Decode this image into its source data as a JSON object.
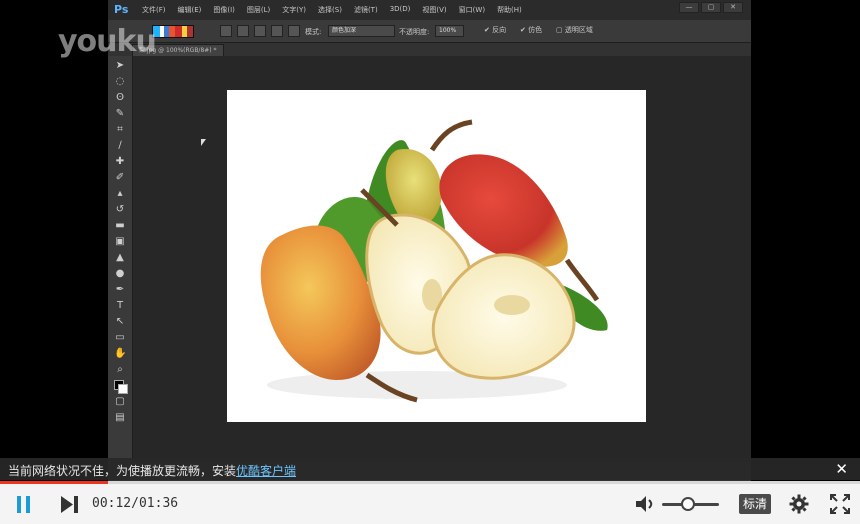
{
  "watermark": "youku",
  "photoshop": {
    "logo": "Ps",
    "menu": [
      "文件(F)",
      "编辑(E)",
      "图像(I)",
      "图层(L)",
      "文字(Y)",
      "选择(S)",
      "滤镜(T)",
      "3D(D)",
      "视图(V)",
      "窗口(W)",
      "帮助(H)"
    ],
    "window_controls": [
      "—",
      "▢",
      "✕"
    ],
    "options": {
      "mode_label": "模式:",
      "mode_value": "颜色加深",
      "opacity_label": "不透明度:",
      "opacity_value": "100%",
      "reverse_label": "反向",
      "dither_label": "仿色",
      "transparency_label": "透明区域"
    },
    "doc_tab": "梨.jpg @ 100%(RGB/8#) *",
    "tools": [
      "move-tool",
      "marquee-tool",
      "lasso-tool",
      "quick-select-tool",
      "crop-tool",
      "eyedropper-tool",
      "healing-tool",
      "brush-tool",
      "clone-stamp-tool",
      "history-brush-tool",
      "eraser-tool",
      "gradient-tool",
      "blur-tool",
      "dodge-tool",
      "pen-tool",
      "type-tool",
      "path-select-tool",
      "shape-tool",
      "hand-tool",
      "zoom-tool"
    ]
  },
  "notice": {
    "text": "当前网络状况不佳，为使播放更流畅，安装",
    "link": "优酷客户端",
    "close": "✕"
  },
  "player": {
    "current_time": "00:12",
    "duration": "01:36",
    "time_display": "00:12/01:36",
    "progress_fraction": 0.125,
    "volume_fraction": 0.45,
    "quality_label": "标清"
  },
  "colors": {
    "accent": "#e33322",
    "ps_logo": "#5fb4ff",
    "notice_link": "#6bc6ff"
  }
}
